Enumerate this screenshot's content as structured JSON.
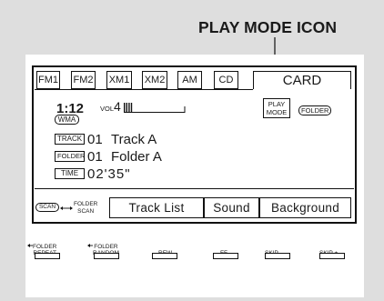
{
  "callout": {
    "label": "PLAY MODE ICON"
  },
  "tabs": [
    "FM1",
    "FM2",
    "XM1",
    "XM2",
    "AM",
    "CD",
    "CARD"
  ],
  "status": {
    "time": "1:12",
    "vol_label": "VOL",
    "vol_value": "4",
    "format": "WMA",
    "play_mode": [
      "PLAY",
      "MODE"
    ],
    "folder_badge": "FOLDER"
  },
  "info_rows": [
    {
      "tag": "TRACK",
      "num": "01",
      "text": "Track A"
    },
    {
      "tag": "FOLDER",
      "num": "01",
      "text": "Folder A"
    },
    {
      "tag": "TIME",
      "num": "02'35\"",
      "text": ""
    }
  ],
  "scan": {
    "badge": "SCAN",
    "folder_scan": [
      "FOLDER",
      "SCAN"
    ]
  },
  "menu": [
    "Track List",
    "Sound",
    "Background"
  ],
  "buttons": [
    {
      "line1": "FOLDER",
      "line2": "REPEAT"
    },
    {
      "line1": "FOLDER",
      "line2": "RANDOM"
    },
    {
      "line1": "",
      "line2": "REW"
    },
    {
      "line1": "",
      "line2": "FF"
    },
    {
      "line1": "",
      "line2": "SKIP -"
    },
    {
      "line1": "",
      "line2": "SKIP +"
    }
  ]
}
